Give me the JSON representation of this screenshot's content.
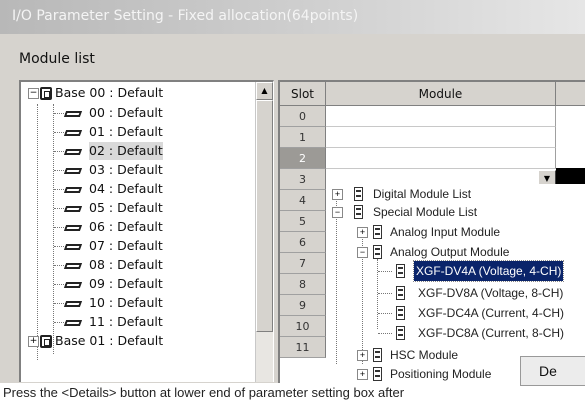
{
  "window": {
    "title": "I/O Parameter Setting - Fixed allocation(64points)"
  },
  "section_label": "Module list",
  "tree": {
    "bases": [
      {
        "label": "Base 00 : Default",
        "expanded": true,
        "icon": "base-rack-icon"
      },
      {
        "label": "Base 01 : Default",
        "expanded": false,
        "icon": "base-rack-icon"
      }
    ],
    "slots": [
      {
        "label": "00 : Default"
      },
      {
        "label": "01 : Default"
      },
      {
        "label": "02 : Default",
        "selected": true
      },
      {
        "label": "03 : Default"
      },
      {
        "label": "04 : Default"
      },
      {
        "label": "05 : Default"
      },
      {
        "label": "06 : Default"
      },
      {
        "label": "07 : Default"
      },
      {
        "label": "08 : Default"
      },
      {
        "label": "09 : Default"
      },
      {
        "label": "10 : Default"
      },
      {
        "label": "11 : Default"
      }
    ]
  },
  "grid": {
    "columns": [
      "Slot",
      "Module"
    ],
    "slots": [
      "0",
      "1",
      "2",
      "3",
      "4",
      "5",
      "6",
      "7",
      "8",
      "9",
      "10",
      "11"
    ],
    "selected_slot": "2"
  },
  "dropdown": {
    "items": [
      {
        "label": "Digital Module List",
        "expander": "+",
        "icon": "module-list-icon"
      },
      {
        "label": "Special Module List",
        "expander": "-",
        "icon": "module-list-icon"
      },
      {
        "label": "Analog Input Module",
        "expander": "+",
        "icon": "module-icon"
      },
      {
        "label": "Analog Output Module",
        "expander": "-",
        "icon": "module-icon"
      },
      {
        "label": "XGF-DV4A (Voltage, 4-CH)",
        "icon": "module-icon",
        "selected": true
      },
      {
        "label": "XGF-DV8A (Voltage, 8-CH)",
        "icon": "module-icon"
      },
      {
        "label": "XGF-DC4A (Current, 4-CH)",
        "icon": "module-icon"
      },
      {
        "label": "XGF-DC8A (Current, 8-CH)",
        "icon": "module-icon"
      },
      {
        "label": "HSC Module",
        "expander": "+",
        "icon": "module-icon"
      },
      {
        "label": "Positioning Module",
        "expander": "+",
        "icon": "module-icon"
      }
    ]
  },
  "details_button": {
    "label": "De"
  },
  "instruction": "Press the <Details> button at lower end of parameter setting box after"
}
